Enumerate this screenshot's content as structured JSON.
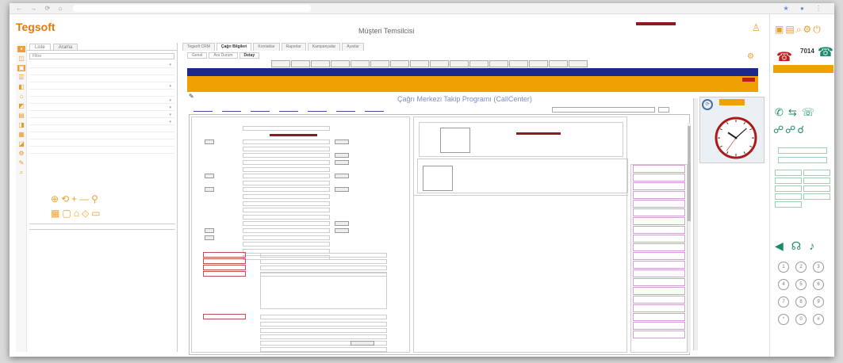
{
  "browser": {
    "nav_icons": "← → ⟳ ⌂",
    "url": "",
    "right_icons": "★ ● ⋮"
  },
  "header": {
    "logo_main": "Tegsoft",
    "logo_sub": "",
    "title": "Müşteri Temsilcisi",
    "user_info_line1": "",
    "user_info_line2": ""
  },
  "left_panel": {
    "tabs": [
      "Liste",
      "Arama"
    ],
    "search_placeholder": "Filtre",
    "rows": [
      {
        "label": "",
        "has_chevron": true
      },
      {
        "label": "",
        "has_chevron": false
      },
      {
        "label": "",
        "has_chevron": false
      },
      {
        "label": "",
        "has_chevron": true
      },
      {
        "label": "",
        "has_chevron": false
      },
      {
        "label": "",
        "has_chevron": true
      },
      {
        "label": "",
        "has_chevron": true
      },
      {
        "label": "",
        "has_chevron": true
      },
      {
        "label": "",
        "has_chevron": true
      },
      {
        "label": "",
        "has_chevron": false
      },
      {
        "label": "",
        "has_chevron": false
      },
      {
        "label": "",
        "has_chevron": false
      },
      {
        "label": "",
        "has_chevron": false
      }
    ],
    "go_label": "",
    "result_label": ""
  },
  "main_tabs": [
    "Tegsoft CRM",
    "Çağrı Bilgileri",
    "Kontaklar",
    "Raporlar",
    "Kampanyalar",
    "Ayarlar"
  ],
  "sub_tabs": [
    "Genel",
    "Ara Durum",
    "Detay"
  ],
  "toolbar_buttons": [
    "",
    "",
    "",
    "",
    "",
    "",
    "",
    "",
    "",
    "",
    "",
    "",
    "",
    "",
    "",
    ""
  ],
  "blue_band_text": "",
  "orange_band": {
    "line1": "",
    "line2": "",
    "right": ""
  },
  "form": {
    "title_line1": "Çağrı Merkezi Takip Programı (CallCenter)",
    "title_line2": "",
    "links": [
      "",
      "",
      "",
      "",
      "",
      "",
      ""
    ],
    "sonuc_label": "",
    "sonuc_value": "",
    "sonuc_btn": "",
    "section_title": "",
    "fields": [
      {
        "label": "",
        "type": "input"
      },
      {
        "label": "",
        "type": "maroon"
      },
      {
        "label": "",
        "type": "input_btn",
        "btn": "",
        "left_btn": ""
      },
      {
        "label": "",
        "type": "input"
      },
      {
        "label": "",
        "type": "input_btn",
        "btn": ""
      },
      {
        "label": "",
        "type": "input_btn",
        "btn": ""
      },
      {
        "label": "",
        "type": "input"
      },
      {
        "label": "",
        "type": "input_btn",
        "btn": "",
        "left_btn": ""
      },
      {
        "label": "",
        "type": "input"
      },
      {
        "label": "",
        "type": "input_btn",
        "btn": "",
        "left_btn": ""
      },
      {
        "label": "",
        "type": "input"
      },
      {
        "label": "",
        "type": "input"
      },
      {
        "label": "",
        "type": "input"
      },
      {
        "label": "",
        "type": "input"
      },
      {
        "label": "",
        "type": "input_btn",
        "btn": ""
      },
      {
        "label": "",
        "type": "input_btn",
        "btn": "",
        "left_btn": ""
      },
      {
        "label": "",
        "type": "input",
        "left_btn": ""
      },
      {
        "label": "",
        "type": "input"
      },
      {
        "label": "",
        "type": "input"
      },
      {
        "label": "",
        "type": "input"
      }
    ],
    "red_labels": [
      "",
      "",
      "",
      ""
    ],
    "bottom_red_label": "",
    "bottom_fields": [
      "",
      "",
      "",
      "",
      ""
    ],
    "bottom_btn": ""
  },
  "mid_panel": {
    "box1_title": "",
    "red_text": "",
    "box2_title": ""
  },
  "right_list": {
    "title": "",
    "items": [
      "",
      "",
      "",
      "",
      "",
      "",
      "",
      "",
      "",
      "",
      "",
      "",
      "",
      "",
      "",
      "",
      "",
      "",
      "",
      ""
    ]
  },
  "clock": {
    "header": "",
    "hour": 10,
    "minute": 8,
    "second": 36
  },
  "phone": {
    "extension": "7014",
    "extension_sub": "",
    "status": "",
    "ready_label": "",
    "buttons": [
      "",
      "",
      "",
      "",
      "",
      "",
      "",
      "",
      "",
      "",
      ""
    ],
    "dial_keys": [
      "1",
      "2",
      "3",
      "4",
      "5",
      "6",
      "7",
      "8",
      "9",
      "*",
      "0",
      "#"
    ]
  },
  "colors": {
    "accent_orange": "#f0a000",
    "nav_blue": "#1b2a88",
    "maroon": "#8a1c25",
    "phone_green": "#1a8a6a"
  }
}
